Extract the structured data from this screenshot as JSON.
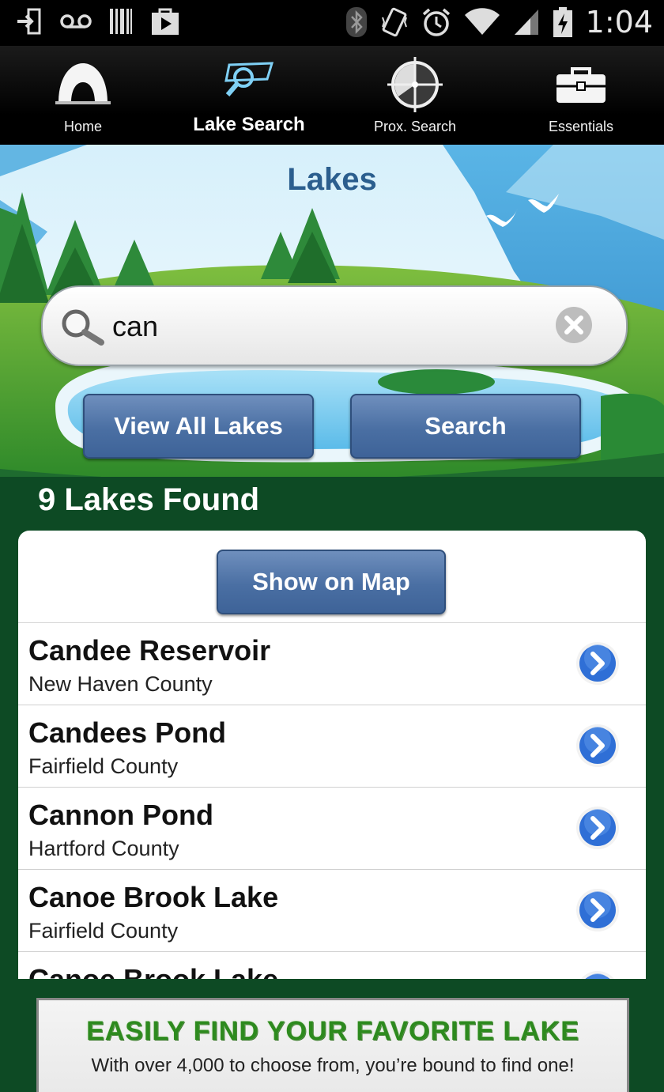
{
  "status_bar": {
    "time": "1:04",
    "left_icons": [
      "sign-in-icon",
      "voicemail-icon",
      "barcode-icon",
      "play-store-icon"
    ],
    "right_icons": [
      "bluetooth-icon",
      "vibrate-icon",
      "alarm-icon",
      "wifi-icon",
      "signal-icon",
      "battery-charging-icon"
    ]
  },
  "nav": {
    "tabs": [
      {
        "label": "Home",
        "icon": "tent-icon"
      },
      {
        "label": "Lake Search",
        "icon": "lake-search-icon",
        "active": true
      },
      {
        "label": "Prox. Search",
        "icon": "crosshair-icon"
      },
      {
        "label": "Essentials",
        "icon": "toolbox-icon"
      }
    ]
  },
  "page": {
    "title": "Lakes"
  },
  "search": {
    "value": "can",
    "view_all_label": "View All Lakes",
    "search_label": "Search"
  },
  "results": {
    "count_text": "9 Lakes  Found",
    "show_map_label": "Show on Map",
    "items": [
      {
        "name": "Candee Reservoir",
        "county": "New Haven County"
      },
      {
        "name": "Candees Pond",
        "county": "Fairfield County"
      },
      {
        "name": "Cannon Pond",
        "county": "Hartford County"
      },
      {
        "name": "Canoe Brook Lake",
        "county": "Fairfield County"
      },
      {
        "name": "Canoe Brook Lake",
        "county": ""
      }
    ]
  },
  "banner": {
    "headline": "EASILY FIND YOUR FAVORITE LAKE",
    "subtext": "With over 4,000 to choose from, you’re bound to find one!"
  },
  "colors": {
    "title_blue": "#2b5e8e",
    "button_blue": "#4a6fa3",
    "forest_green": "#0d4a24",
    "banner_green": "#2d8a1e",
    "chevron_blue": "#2f6fd6"
  }
}
